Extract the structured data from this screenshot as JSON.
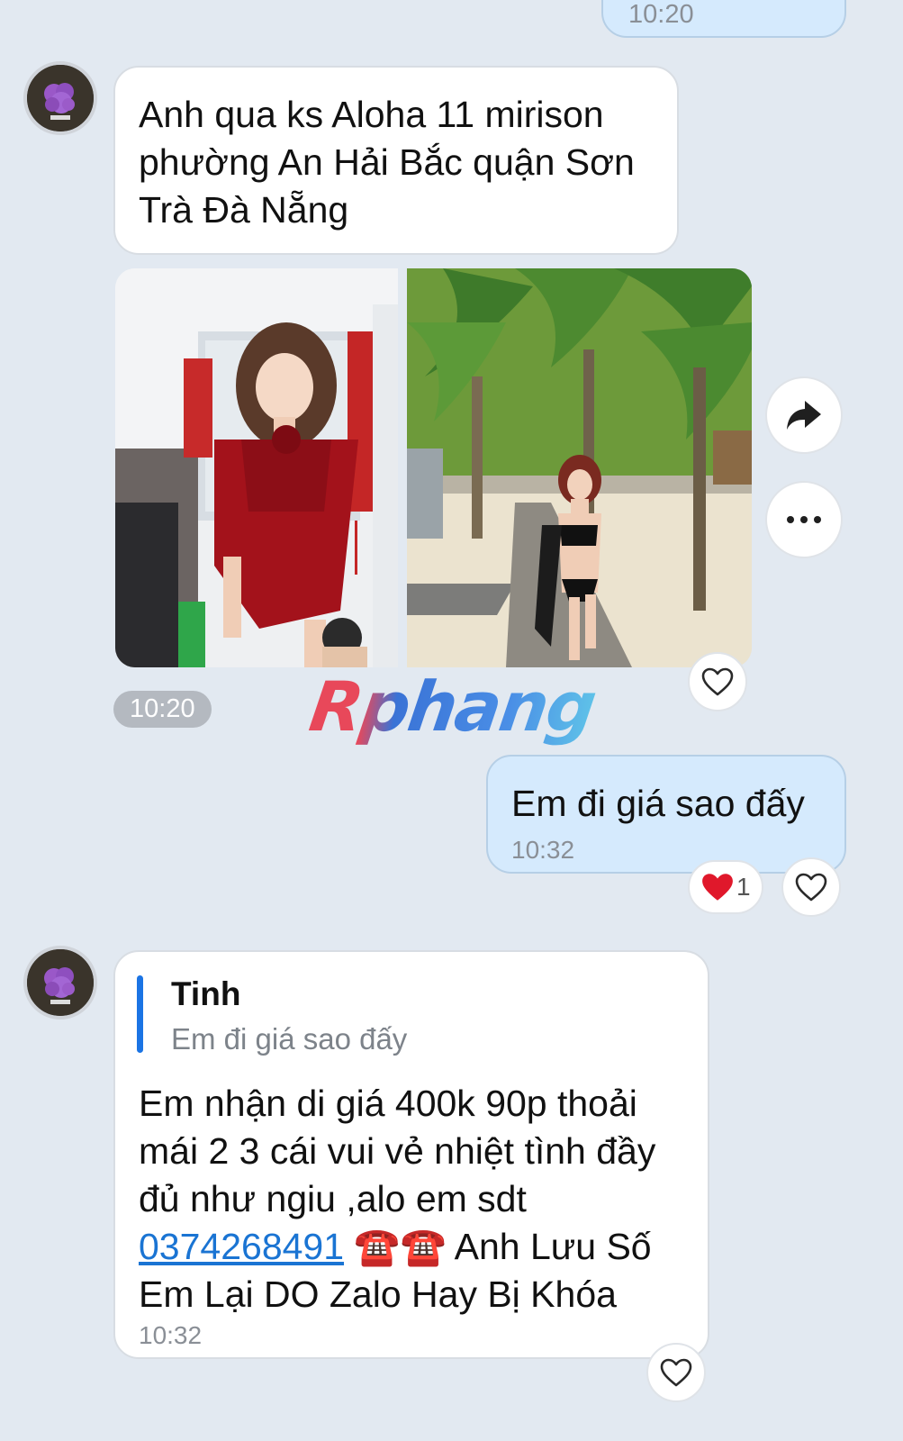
{
  "messages": {
    "top_time": "10:20",
    "m1_text": "Anh qua ks Aloha 11 mirison phường An Hải Bắc quận Sơn Trà Đà Nẵng",
    "photos_time": "10:20",
    "m2_text": "Em đi giá sao đấy",
    "m2_time": "10:32",
    "m2_reaction_count": "1",
    "m3_quote_name": "Tinh",
    "m3_quote_text": "Em đi giá sao đấy",
    "m3_text_part1": "Em nhận di giá 400k 90p thoải mái 2 3 cái vui vẻ nhiệt tình đầy đủ như ngiu ,alo em sdt ",
    "m3_phone": "0374268491",
    "m3_emoji": " ☎️☎️ ",
    "m3_text_part2": "Anh Lưu Số Em Lại DO Zalo Hay Bị Khóa",
    "m3_time": "10:32"
  },
  "watermark": "Rphang",
  "icons": {
    "share": "share-arrow-icon",
    "more": "more-dots-icon",
    "heart": "heart-outline-icon",
    "reaction": "red-heart-icon"
  },
  "colors": {
    "background": "#e2e9f1",
    "outgoing_bubble": "#d5eafd",
    "incoming_bubble": "#ffffff",
    "link": "#1a74d3",
    "quote_bar": "#1b74e4"
  }
}
